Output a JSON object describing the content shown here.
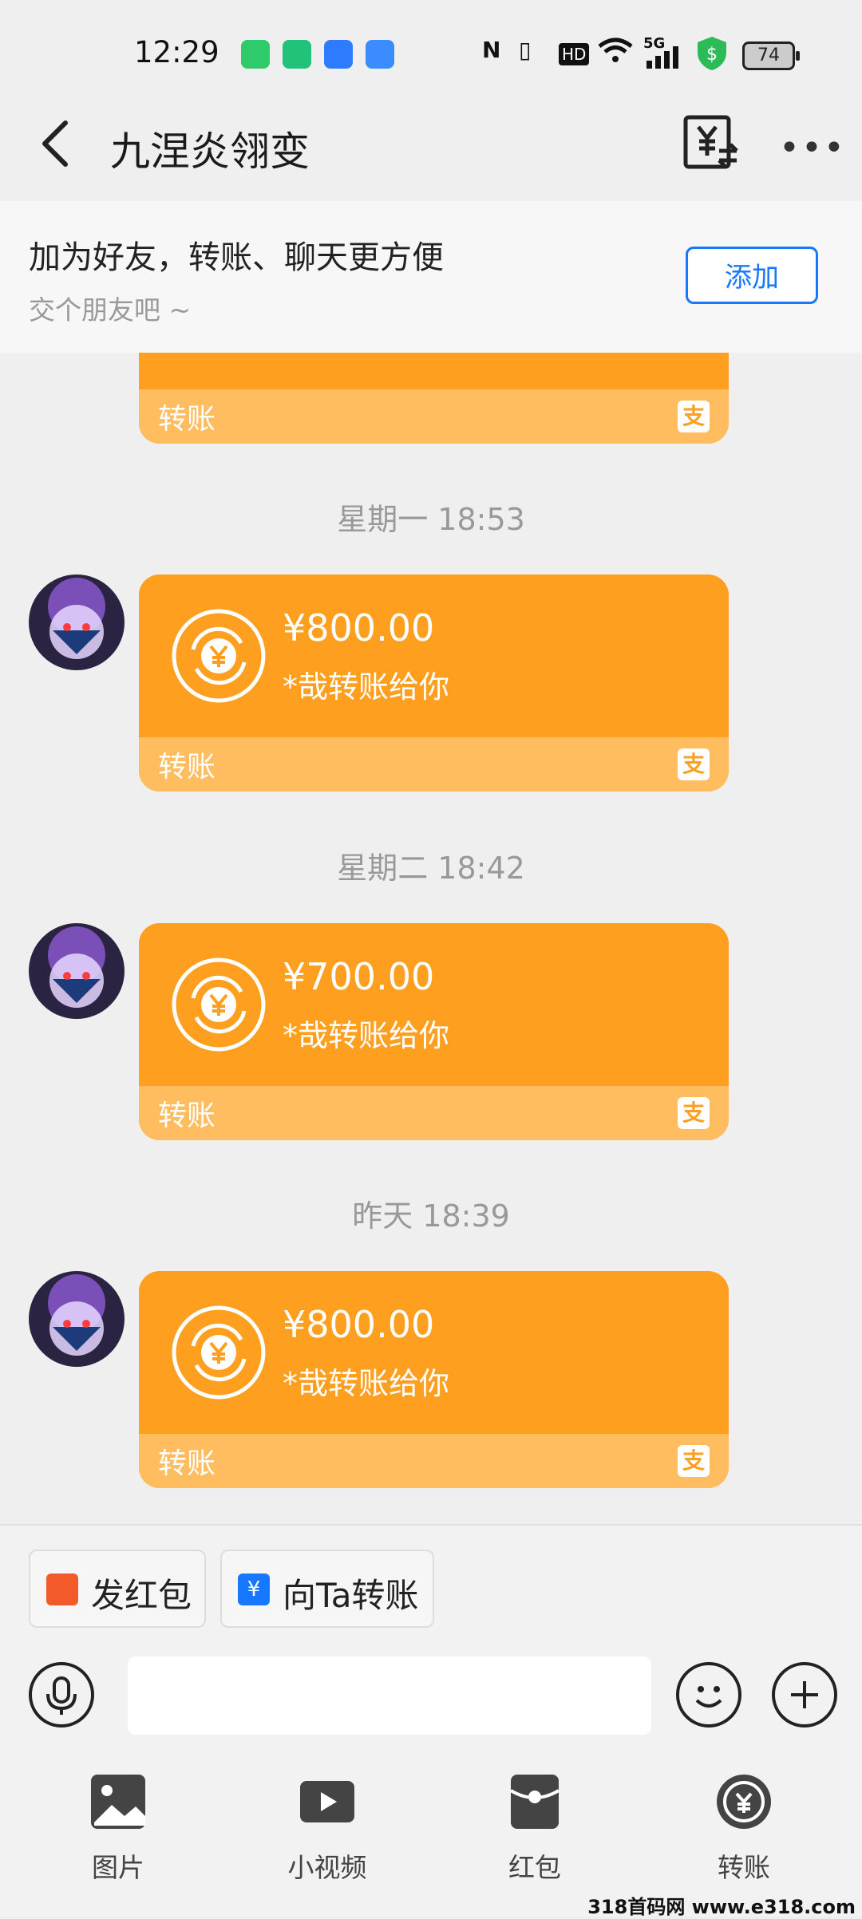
{
  "status_bar": {
    "time": "12:29",
    "hd": "HD",
    "signal": "5G",
    "battery": "74"
  },
  "header": {
    "title": "九涅炎翎变",
    "more": "•••"
  },
  "banner": {
    "title": "加为好友，转账、聊天更方便",
    "subtitle": "交个朋友吧 ~",
    "add_label": "添加"
  },
  "messages": [
    {
      "timestamp": "星期一 18:53",
      "amount": "¥800.00",
      "note": "*哉转账给你",
      "label": "转账"
    },
    {
      "timestamp": "星期二 18:42",
      "amount": "¥700.00",
      "note": "*哉转账给你",
      "label": "转账"
    },
    {
      "timestamp": "昨天 18:39",
      "amount": "¥800.00",
      "note": "*哉转账给你",
      "label": "转账"
    }
  ],
  "partial_card": {
    "label": "转账"
  },
  "alipay_glyph": "支",
  "quick_actions": [
    {
      "label": "发红包",
      "icon": "red-envelope-icon"
    },
    {
      "label": "向Ta转账",
      "icon": "transfer-icon"
    }
  ],
  "input": {
    "placeholder": ""
  },
  "toolbar": [
    {
      "label": "图片",
      "icon": "image-icon"
    },
    {
      "label": "小视频",
      "icon": "video-icon"
    },
    {
      "label": "红包",
      "icon": "red-envelope-icon"
    },
    {
      "label": "转账",
      "icon": "transfer-icon"
    }
  ],
  "watermark": "318首码网 www.e318.com",
  "colors": {
    "card_orange": "#ff9f1f",
    "card_footer": "#ffbd60",
    "accent_blue": "#1677ff"
  }
}
